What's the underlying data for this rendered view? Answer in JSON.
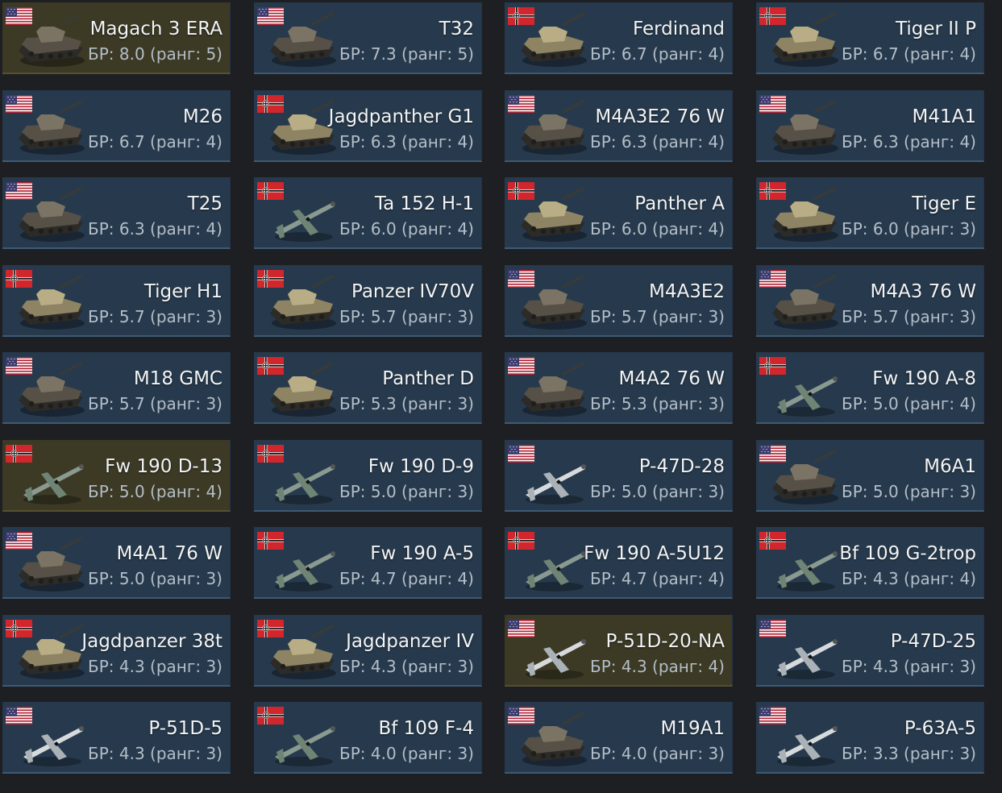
{
  "br_prefix": "БР:",
  "rank_prefix": "ранг:",
  "colors": {
    "card_bg": "#273a4d",
    "card_highlight_bg": "#3c3a25",
    "page_bg": "#1e1f22",
    "name_text": "#f2f4f6",
    "br_text": "#b4bec8"
  },
  "vehicles": [
    {
      "name": "Magach 3 ERA",
      "br_text": "БР: 8.0 (ранг: 5)",
      "br": "8.0",
      "rank": 5,
      "nation": "usa",
      "type": "tank",
      "highlighted": true
    },
    {
      "name": "T32",
      "br_text": "БР: 7.3 (ранг: 5)",
      "br": "7.3",
      "rank": 5,
      "nation": "usa",
      "type": "tank",
      "highlighted": false
    },
    {
      "name": "Ferdinand",
      "br_text": "БР: 6.7 (ранг: 4)",
      "br": "6.7",
      "rank": 4,
      "nation": "germany",
      "type": "tank",
      "highlighted": false
    },
    {
      "name": "Tiger II P",
      "br_text": "БР: 6.7 (ранг: 4)",
      "br": "6.7",
      "rank": 4,
      "nation": "germany",
      "type": "tank",
      "highlighted": false
    },
    {
      "name": "M26",
      "br_text": "БР: 6.7 (ранг: 4)",
      "br": "6.7",
      "rank": 4,
      "nation": "usa",
      "type": "tank",
      "highlighted": false
    },
    {
      "name": "Jagdpanther G1",
      "br_text": "БР: 6.3 (ранг: 4)",
      "br": "6.3",
      "rank": 4,
      "nation": "germany",
      "type": "tank",
      "highlighted": false
    },
    {
      "name": "M4A3E2 76 W",
      "br_text": "БР: 6.3 (ранг: 4)",
      "br": "6.3",
      "rank": 4,
      "nation": "usa",
      "type": "tank",
      "highlighted": false
    },
    {
      "name": "M41A1",
      "br_text": "БР: 6.3 (ранг: 4)",
      "br": "6.3",
      "rank": 4,
      "nation": "usa",
      "type": "tank",
      "highlighted": false
    },
    {
      "name": "T25",
      "br_text": "БР: 6.3 (ранг: 4)",
      "br": "6.3",
      "rank": 4,
      "nation": "usa",
      "type": "tank",
      "highlighted": false
    },
    {
      "name": "Ta 152 H-1",
      "br_text": "БР: 6.0 (ранг: 4)",
      "br": "6.0",
      "rank": 4,
      "nation": "germany",
      "type": "plane",
      "highlighted": false
    },
    {
      "name": "Panther A",
      "br_text": "БР: 6.0 (ранг: 4)",
      "br": "6.0",
      "rank": 4,
      "nation": "germany",
      "type": "tank",
      "highlighted": false
    },
    {
      "name": "Tiger E",
      "br_text": "БР: 6.0 (ранг: 3)",
      "br": "6.0",
      "rank": 3,
      "nation": "germany",
      "type": "tank",
      "highlighted": false
    },
    {
      "name": "Tiger H1",
      "br_text": "БР: 5.7 (ранг: 3)",
      "br": "5.7",
      "rank": 3,
      "nation": "germany",
      "type": "tank",
      "highlighted": false
    },
    {
      "name": "Panzer IV70V",
      "br_text": "БР: 5.7 (ранг: 3)",
      "br": "5.7",
      "rank": 3,
      "nation": "germany",
      "type": "tank",
      "highlighted": false
    },
    {
      "name": "M4A3E2",
      "br_text": "БР: 5.7 (ранг: 3)",
      "br": "5.7",
      "rank": 3,
      "nation": "usa",
      "type": "tank",
      "highlighted": false
    },
    {
      "name": "M4A3 76 W",
      "br_text": "БР: 5.7 (ранг: 3)",
      "br": "5.7",
      "rank": 3,
      "nation": "usa",
      "type": "tank",
      "highlighted": false
    },
    {
      "name": "M18 GMC",
      "br_text": "БР: 5.7 (ранг: 3)",
      "br": "5.7",
      "rank": 3,
      "nation": "usa",
      "type": "tank",
      "highlighted": false
    },
    {
      "name": "Panther D",
      "br_text": "БР: 5.3 (ранг: 3)",
      "br": "5.3",
      "rank": 3,
      "nation": "germany",
      "type": "tank",
      "highlighted": false
    },
    {
      "name": "M4A2 76 W",
      "br_text": "БР: 5.3 (ранг: 3)",
      "br": "5.3",
      "rank": 3,
      "nation": "usa",
      "type": "tank",
      "highlighted": false
    },
    {
      "name": "Fw 190 A-8",
      "br_text": "БР: 5.0 (ранг: 4)",
      "br": "5.0",
      "rank": 4,
      "nation": "germany",
      "type": "plane",
      "highlighted": false
    },
    {
      "name": "Fw 190 D-13",
      "br_text": "БР: 5.0 (ранг: 4)",
      "br": "5.0",
      "rank": 4,
      "nation": "germany",
      "type": "plane",
      "highlighted": true
    },
    {
      "name": "Fw 190 D-9",
      "br_text": "БР: 5.0 (ранг: 3)",
      "br": "5.0",
      "rank": 3,
      "nation": "germany",
      "type": "plane",
      "highlighted": false
    },
    {
      "name": "P-47D-28",
      "br_text": "БР: 5.0 (ранг: 3)",
      "br": "5.0",
      "rank": 3,
      "nation": "usa",
      "type": "plane",
      "highlighted": false
    },
    {
      "name": "M6A1",
      "br_text": "БР: 5.0 (ранг: 3)",
      "br": "5.0",
      "rank": 3,
      "nation": "usa",
      "type": "tank",
      "highlighted": false
    },
    {
      "name": "M4A1 76 W",
      "br_text": "БР: 5.0 (ранг: 3)",
      "br": "5.0",
      "rank": 3,
      "nation": "usa",
      "type": "tank",
      "highlighted": false
    },
    {
      "name": "Fw 190 A-5",
      "br_text": "БР: 4.7 (ранг: 4)",
      "br": "4.7",
      "rank": 4,
      "nation": "germany",
      "type": "plane",
      "highlighted": false
    },
    {
      "name": "Fw 190 A-5U12",
      "br_text": "БР: 4.7 (ранг: 4)",
      "br": "4.7",
      "rank": 4,
      "nation": "germany",
      "type": "plane",
      "highlighted": false
    },
    {
      "name": "Bf 109 G-2trop",
      "br_text": "БР: 4.3 (ранг: 4)",
      "br": "4.3",
      "rank": 4,
      "nation": "germany",
      "type": "plane",
      "highlighted": false
    },
    {
      "name": "Jagdpanzer 38t",
      "br_text": "БР: 4.3 (ранг: 3)",
      "br": "4.3",
      "rank": 3,
      "nation": "germany",
      "type": "tank",
      "highlighted": false
    },
    {
      "name": "Jagdpanzer IV",
      "br_text": "БР: 4.3 (ранг: 3)",
      "br": "4.3",
      "rank": 3,
      "nation": "germany",
      "type": "tank",
      "highlighted": false
    },
    {
      "name": "P-51D-20-NA",
      "br_text": "БР: 4.3 (ранг: 4)",
      "br": "4.3",
      "rank": 4,
      "nation": "usa",
      "type": "plane",
      "highlighted": true
    },
    {
      "name": "P-47D-25",
      "br_text": "БР: 4.3 (ранг: 3)",
      "br": "4.3",
      "rank": 3,
      "nation": "usa",
      "type": "plane",
      "highlighted": false
    },
    {
      "name": "P-51D-5",
      "br_text": "БР: 4.3 (ранг: 3)",
      "br": "4.3",
      "rank": 3,
      "nation": "usa",
      "type": "plane",
      "highlighted": false
    },
    {
      "name": "Bf 109 F-4",
      "br_text": "БР: 4.0 (ранг: 3)",
      "br": "4.0",
      "rank": 3,
      "nation": "germany",
      "type": "plane",
      "highlighted": false
    },
    {
      "name": "M19A1",
      "br_text": "БР: 4.0 (ранг: 3)",
      "br": "4.0",
      "rank": 3,
      "nation": "usa",
      "type": "tank",
      "highlighted": false
    },
    {
      "name": "P-63A-5",
      "br_text": "БР: 3.3 (ранг: 3)",
      "br": "3.3",
      "rank": 3,
      "nation": "usa",
      "type": "plane",
      "highlighted": false
    }
  ]
}
